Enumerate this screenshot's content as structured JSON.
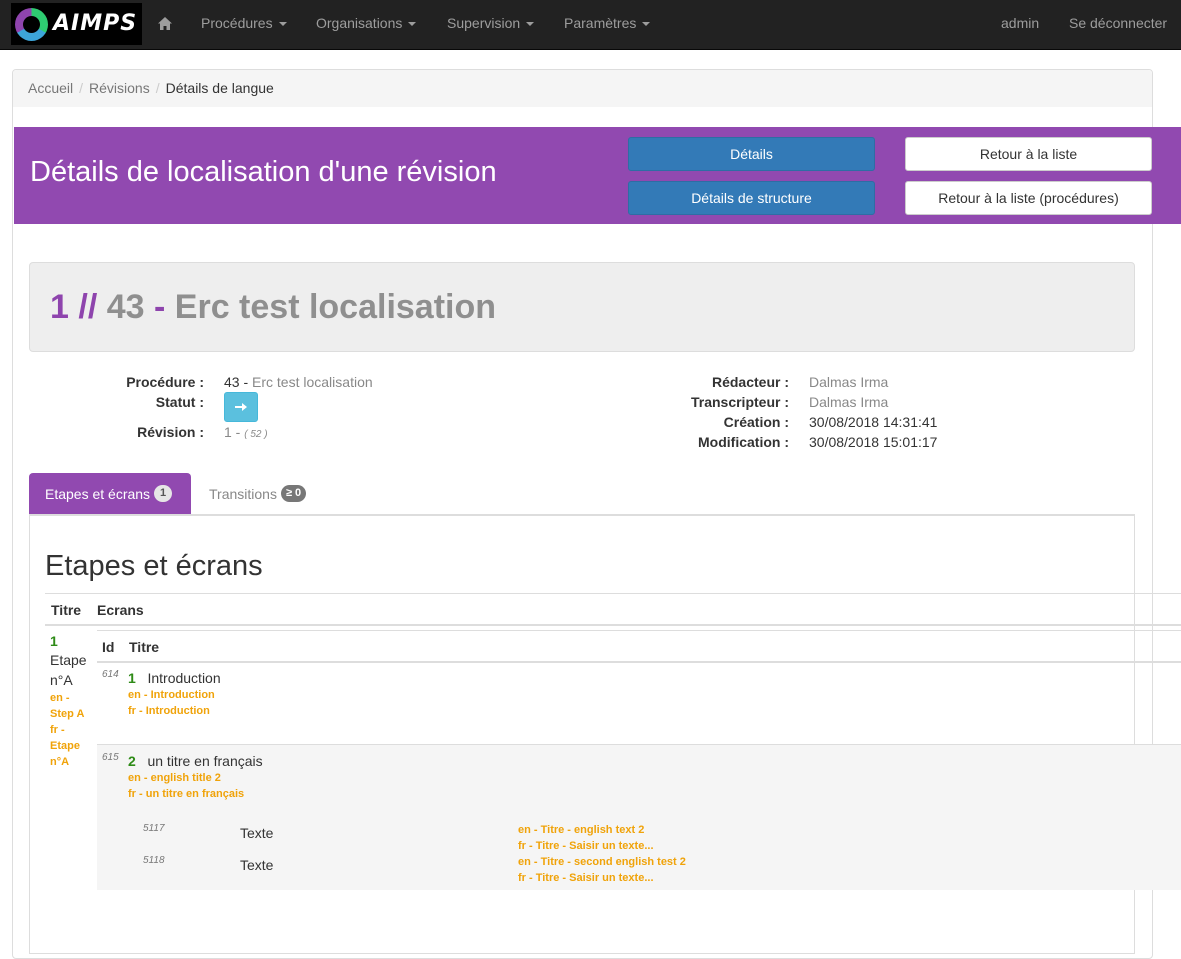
{
  "navbar": {
    "logo_text": "AIMPS",
    "home_icon": "home-icon",
    "menus": [
      {
        "label": "Procédures"
      },
      {
        "label": "Organisations"
      },
      {
        "label": "Supervision"
      },
      {
        "label": "Paramètres"
      }
    ],
    "user": "admin",
    "logout": "Se déconnecter"
  },
  "breadcrumb": {
    "items": [
      "Accueil",
      "Révisions"
    ],
    "separator": "/",
    "active": "Détails de langue"
  },
  "header": {
    "title": "Détails de localisation d'une révision",
    "buttons": {
      "details": "Détails",
      "structure": "Détails de structure",
      "back_list": "Retour à la liste",
      "back_list_procedures": "Retour à la liste (procédures)"
    },
    "accent_color": "#8e44ad"
  },
  "jumbotron": {
    "revision": "1",
    "sep": "//",
    "procedure_id": "43",
    "dash": "-",
    "procedure_name": "Erc test localisation"
  },
  "meta": {
    "procedure_label": "Procédure :",
    "procedure_id": "43",
    "procedure_dash": "-",
    "procedure_name": "Erc test localisation",
    "status_label": "Statut :",
    "status_icon": "arrow-right-icon",
    "revision_label": "Révision :",
    "revision_value": "1 -",
    "revision_extra": "( 52 )",
    "redacteur_label": "Rédacteur :",
    "redacteur_value": "Dalmas Irma",
    "transcripteur_label": "Transcripteur :",
    "transcripteur_value": "Dalmas Irma",
    "creation_label": "Création :",
    "creation_value": "30/08/2018 14:31:41",
    "modification_label": "Modification :",
    "modification_value": "30/08/2018 15:01:17"
  },
  "tabs": [
    {
      "label": "Etapes et écrans",
      "badge": "1",
      "active": true
    },
    {
      "label": "Transitions",
      "badge": "≥ 0",
      "active": false
    }
  ],
  "section": {
    "title": "Etapes et écrans",
    "columns": {
      "titre": "Titre",
      "ecrans": "Ecrans"
    },
    "sub_columns": {
      "id": "Id",
      "titre": "Titre"
    },
    "step": {
      "num": "1",
      "name_line1": "Etape",
      "name_line2": "n°A",
      "loc": [
        "en -",
        "Step A",
        "fr -",
        "Etape",
        "n°A"
      ]
    },
    "screens": [
      {
        "id": "614",
        "num": "1",
        "title": "Introduction",
        "loc": [
          "en - Introduction",
          "fr - Introduction"
        ]
      },
      {
        "id": "615",
        "num": "2",
        "title": "un titre en français",
        "loc": [
          "en - english title 2",
          "fr - un titre en français"
        ],
        "fields": [
          {
            "id": "5117",
            "type": "Texte",
            "loc": [
              "en - Titre - english text 2",
              "fr - Titre - Saisir un texte..."
            ]
          },
          {
            "id": "5118",
            "type": "Texte",
            "loc": [
              "en - Titre - second english test 2",
              "fr - Titre - Saisir un texte..."
            ]
          }
        ]
      }
    ]
  }
}
